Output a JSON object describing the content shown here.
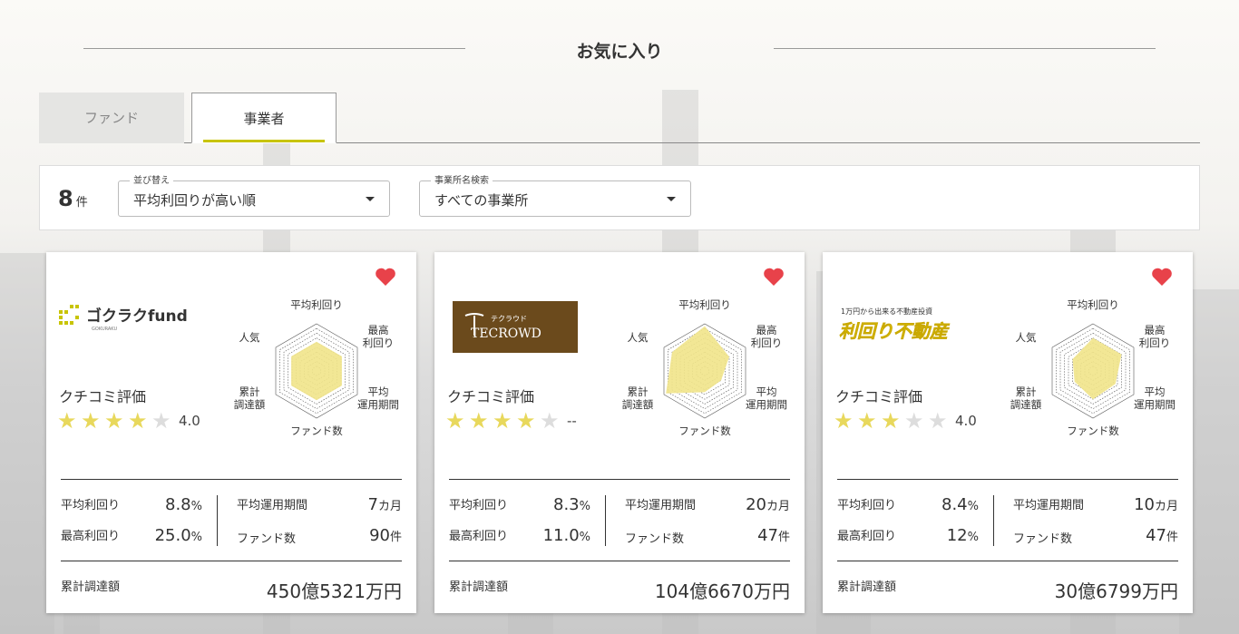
{
  "page_title": "お気に入り",
  "tabs": [
    {
      "label": "ファンド",
      "active": false
    },
    {
      "label": "事業者",
      "active": true
    }
  ],
  "filter": {
    "count": "8",
    "count_unit": "件",
    "sort_label": "並び替え",
    "sort_value": "平均利回りが高い順",
    "search_label": "事業所名検索",
    "search_value": "すべての事業所"
  },
  "colors": {
    "accent": "#c8c400",
    "star_on": "#e8d85c",
    "heart": "#e8424a",
    "radar_fill": "#f1e48a"
  },
  "radar_axes": [
    "平均利回り",
    "最高利回り",
    "平均運用期間",
    "ファンド数",
    "累計調達額",
    "人気"
  ],
  "radar_axis_lines": {
    "max_yield": [
      "最高",
      "利回り"
    ],
    "avg_period": [
      "平均",
      "運用期間"
    ],
    "total_raised": [
      "累計",
      "調達額"
    ]
  },
  "rating_label": "クチコミ評価",
  "stat_labels": {
    "avg_yield": "平均利回り",
    "max_yield": "最高利回り",
    "avg_period": "平均運用期間",
    "fund_count": "ファンド数",
    "total_raised": "累計調達額"
  },
  "cards": [
    {
      "logo_text": "ゴクラクfund",
      "logo_sub": "GOKURAKU",
      "favorited": true,
      "stars": 4,
      "score": "4.0",
      "radar_values": [
        0.62,
        0.62,
        0.62,
        0.62,
        0.62,
        0.62
      ],
      "avg_yield": "8.8",
      "avg_yield_unit": "%",
      "max_yield": "25.0",
      "max_yield_unit": "%",
      "avg_period": "7",
      "avg_period_unit": "カ月",
      "fund_count": "90",
      "fund_count_unit": "件",
      "total_raised": "450億5321万円"
    },
    {
      "logo_text": "TECROWD",
      "logo_sub": "テクラウド",
      "favorited": true,
      "stars": 4,
      "score": "--",
      "radar_values": [
        0.95,
        0.6,
        0.4,
        0.45,
        0.95,
        0.8
      ],
      "avg_yield": "8.3",
      "avg_yield_unit": "%",
      "max_yield": "11.0",
      "max_yield_unit": "%",
      "avg_period": "20",
      "avg_period_unit": "カ月",
      "fund_count": "47",
      "fund_count_unit": "件",
      "total_raised": "104億6670万円"
    },
    {
      "logo_text": "利回り不動産",
      "logo_sub": "1万円から出来る不動産投資",
      "favorited": true,
      "stars": 3,
      "score": "4.0",
      "radar_values": [
        0.7,
        0.7,
        0.55,
        0.6,
        0.45,
        0.5
      ],
      "avg_yield": "8.4",
      "avg_yield_unit": "%",
      "max_yield": "12",
      "max_yield_unit": "%",
      "avg_period": "10",
      "avg_period_unit": "カ月",
      "fund_count": "47",
      "fund_count_unit": "件",
      "total_raised": "30億6799万円"
    }
  ]
}
